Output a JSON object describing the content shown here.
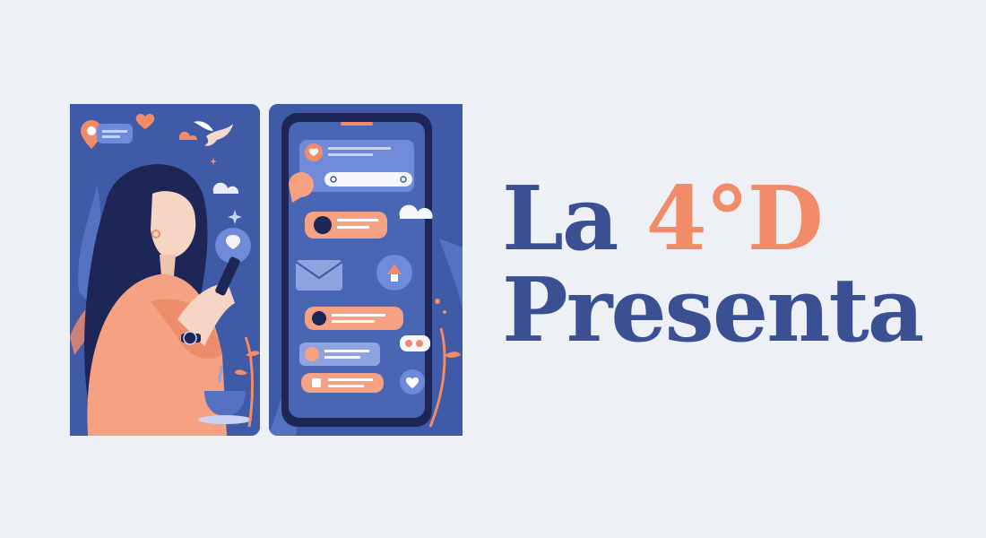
{
  "headline": {
    "line1_word1": "La",
    "line1_word2": "4°D",
    "line2": "Presenta"
  },
  "colors": {
    "background": "#edf0f5",
    "text_blue": "#3b4f93",
    "text_orange": "#f28b68",
    "panel_blue": "#3f5aa6",
    "accent_peach": "#f5a182"
  },
  "illustration": {
    "left_panel": "woman-with-phone",
    "right_panel": "phone-chat-screen"
  }
}
